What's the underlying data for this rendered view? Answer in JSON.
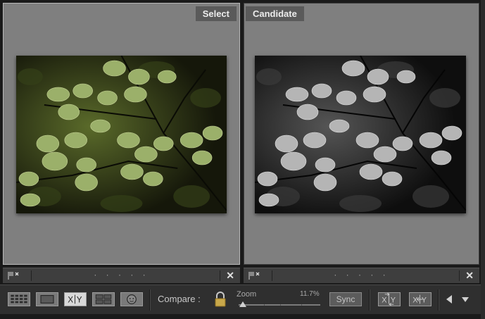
{
  "panes": {
    "select_label": "Select",
    "candidate_label": "Candidate"
  },
  "strip": {
    "rating_dots": "· · · · ·",
    "close_glyph": "✕"
  },
  "toolbar": {
    "compare_label": "Compare :",
    "zoom_label": "Zoom",
    "zoom_value": "11.7%",
    "sync_label": "Sync",
    "view_modes": [
      "grid-view",
      "loupe-view",
      "compare-view",
      "survey-view",
      "people-view"
    ],
    "compare_view_text": "X|Y"
  },
  "colors": {
    "panel_background": "#7f7f7f",
    "toolbar_background": "#2f2f2f",
    "selected_border": "#b8b8b8"
  }
}
